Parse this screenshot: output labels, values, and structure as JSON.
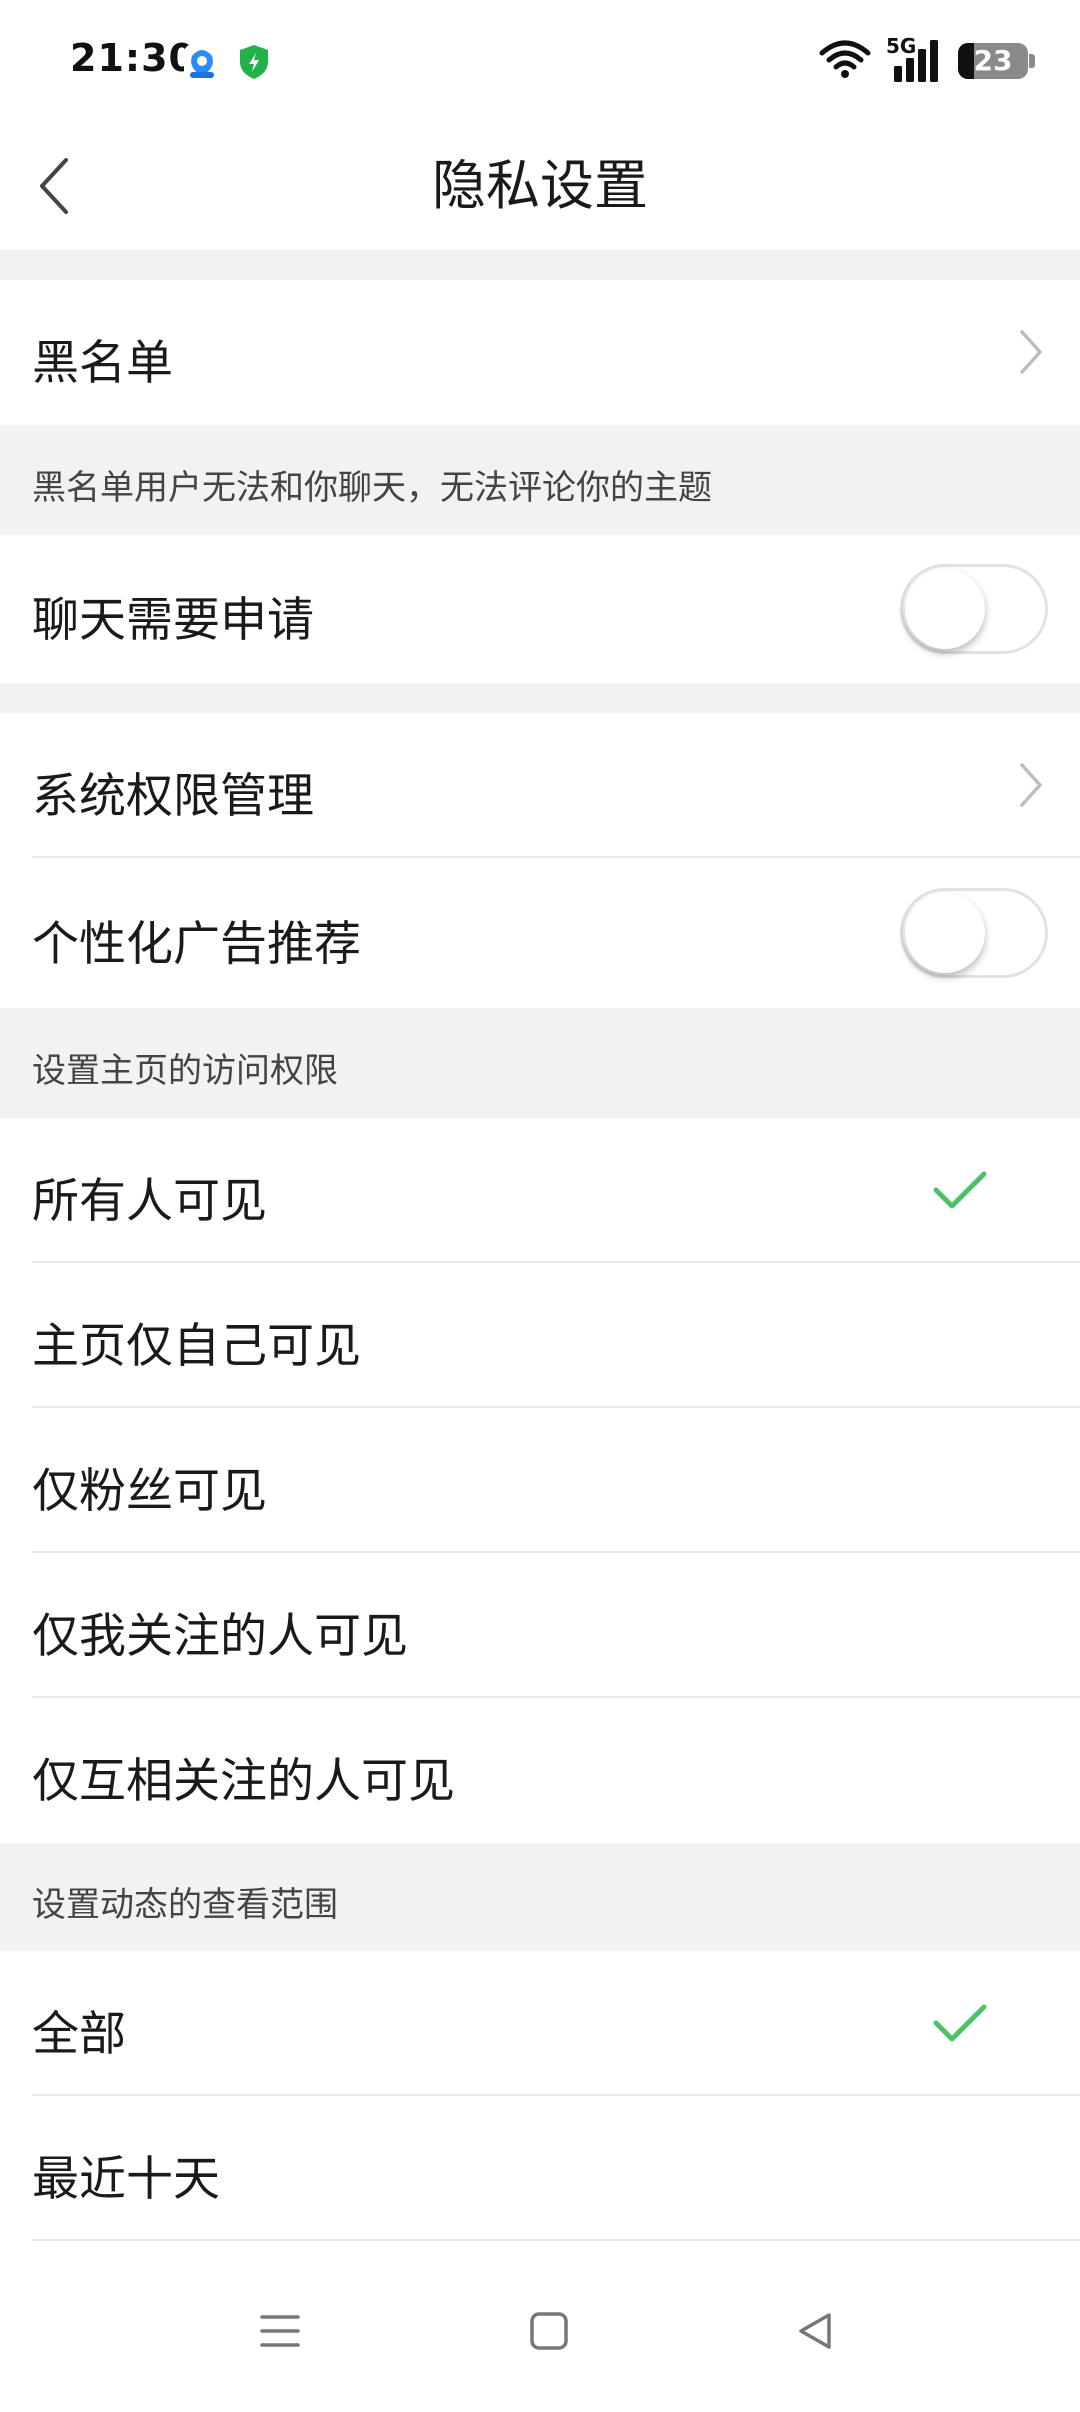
{
  "status_bar": {
    "time": "21:30",
    "battery": "23",
    "battery_level_percent": 23,
    "network": "5G",
    "icons": [
      "baidu-app-icon",
      "security-shield-icon",
      "wifi-icon",
      "cellular-signal-icon",
      "battery-icon"
    ]
  },
  "header": {
    "title": "隐私设置",
    "back_icon": "chevron-left-icon"
  },
  "blacklist": {
    "label": "黑名单",
    "hint": "黑名单用户无法和你聊天，无法评论你的主题"
  },
  "chat_request": {
    "label": "聊天需要申请",
    "enabled": false
  },
  "system_permissions": {
    "label": "系统权限管理"
  },
  "personalized_ads": {
    "label": "个性化广告推荐",
    "enabled": false
  },
  "homepage_visibility": {
    "section_title": "设置主页的访问权限",
    "options": [
      {
        "label": "所有人可见",
        "selected": true
      },
      {
        "label": "主页仅自己可见",
        "selected": false
      },
      {
        "label": "仅粉丝可见",
        "selected": false
      },
      {
        "label": "仅我关注的人可见",
        "selected": false
      },
      {
        "label": "仅互相关注的人可见",
        "selected": false
      }
    ]
  },
  "feed_range": {
    "section_title": "设置动态的查看范围",
    "options": [
      {
        "label": "全部",
        "selected": true
      },
      {
        "label": "最近十天",
        "selected": false
      }
    ]
  },
  "colors": {
    "accent_check": "#4cc168",
    "section_background": "#f2f2f2",
    "divider": "#e8e8e8"
  },
  "system_nav": {
    "icons": [
      "menu-icon",
      "home-square-icon",
      "back-triangle-icon"
    ]
  }
}
